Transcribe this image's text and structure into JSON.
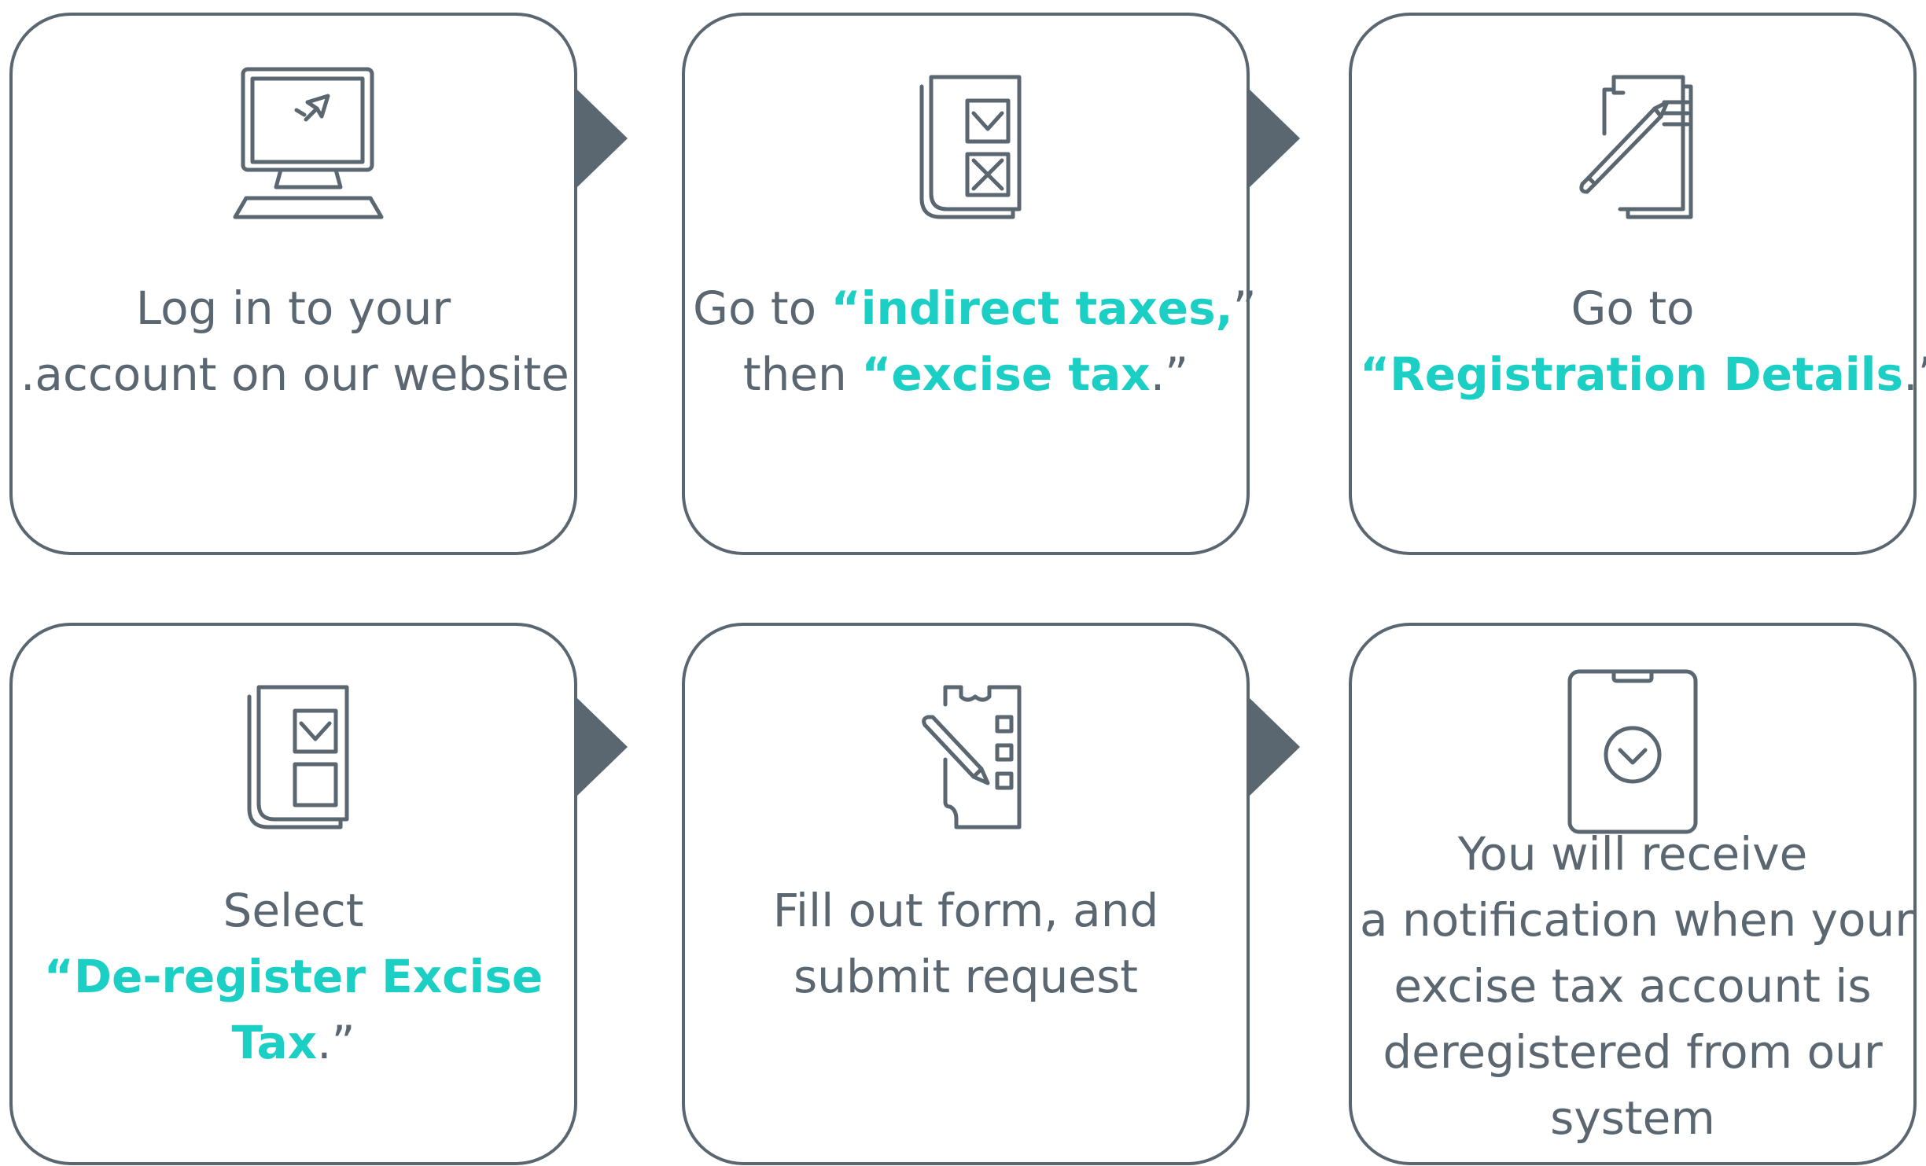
{
  "colors": {
    "stroke": "#5a6670",
    "highlight": "#1ccfc4",
    "background": "#ffffff"
  },
  "steps": [
    {
      "icon": "computer-icon",
      "line1": "Log in to your",
      "line2": ".account on our website"
    },
    {
      "icon": "checklist-document-icon",
      "line1_a": "Go to ",
      "line1_b": "“",
      "line1_c": "indirect taxes,",
      "line1_d": "”",
      "line2_a": "then ",
      "line2_b": "“",
      "line2_c": "excise tax",
      "line2_d": ".”"
    },
    {
      "icon": "document-pencil-icon",
      "line1": "Go to",
      "line2_a": "“",
      "line2_b": "Registration Details",
      "line2_c": ".”"
    },
    {
      "icon": "checkbox-document-icon",
      "line1": "Select",
      "line2_a": "“",
      "line2_b": "De-register Excise",
      "line3_a": "Tax",
      "line3_b": ".”"
    },
    {
      "icon": "form-pencil-icon",
      "line1": "Fill out form, and",
      "line2": "submit request"
    },
    {
      "icon": "phone-notification-icon",
      "line1": "You will receive",
      "line2": "a notification when your",
      "line3": "excise tax account is",
      "line4": "deregistered from our",
      "line5": "system"
    }
  ]
}
